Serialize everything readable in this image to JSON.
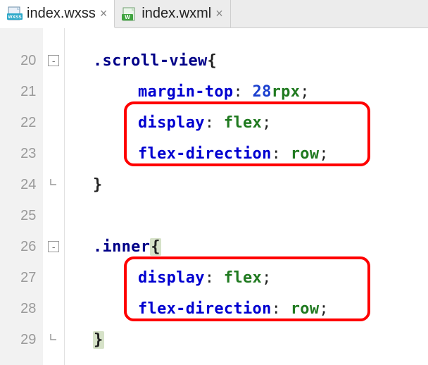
{
  "tabs": [
    {
      "label": "index.wxss",
      "icon": "wxss",
      "active": true
    },
    {
      "label": "index.wxml",
      "icon": "wxml",
      "active": false
    }
  ],
  "close_glyph": "×",
  "line_start": 20,
  "line_end": 29,
  "fold": {
    "open_glyph": "-",
    "20": "open",
    "24": "close",
    "26": "open",
    "29": "close"
  },
  "code": {
    "l20": {
      "sel": ".scroll-view",
      "brace": "{"
    },
    "l21": {
      "prop": "margin-top",
      "num": "28",
      "unit": "rpx"
    },
    "l22": {
      "prop": "display",
      "val": "flex"
    },
    "l23": {
      "prop": "flex-direction",
      "val": "row"
    },
    "l24": {
      "brace": "}"
    },
    "l26": {
      "sel": ".inner",
      "brace": "{"
    },
    "l27": {
      "prop": "display",
      "val": "flex"
    },
    "l28": {
      "prop": "flex-direction",
      "val": "row"
    },
    "l29": {
      "brace": "}"
    }
  },
  "colors": {
    "highlight_border": "#ff0000"
  }
}
